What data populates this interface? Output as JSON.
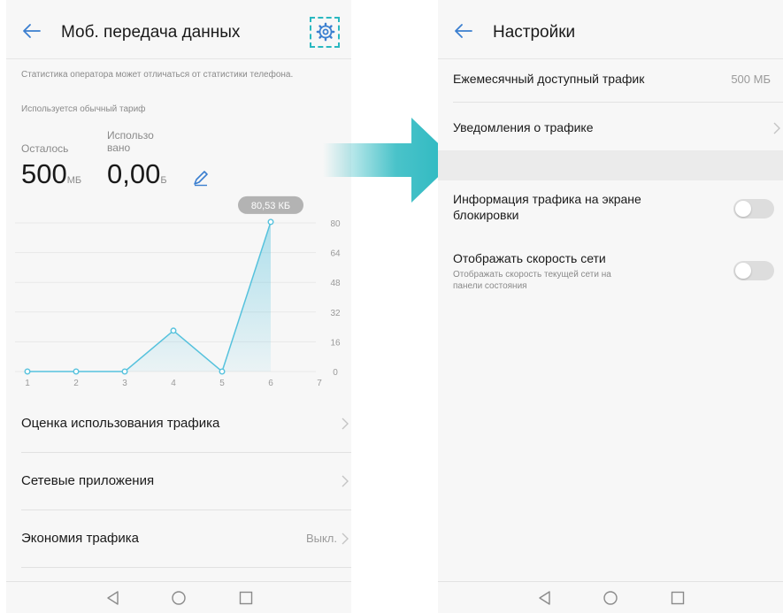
{
  "left": {
    "title": "Моб. передача данных",
    "note": "Статистика оператора может отличаться от статистики телефона.",
    "tariff": "Используется обычный тариф",
    "remaining": {
      "label": "Осталось",
      "value": "500",
      "unit": "МБ"
    },
    "used": {
      "label_line1": "Использо",
      "label_line2": "вано",
      "value": "0,00",
      "unit": "Б"
    },
    "rows": [
      {
        "label": "Оценка использования трафика",
        "value": ""
      },
      {
        "label": "Сетевые приложения",
        "value": ""
      },
      {
        "label": "Экономия трафика",
        "value": "Выкл."
      }
    ]
  },
  "right": {
    "title": "Настройки",
    "monthly": {
      "label": "Ежемесячный доступный трафик",
      "value": "500 МБ"
    },
    "alerts": {
      "label": "Уведомления о трафике"
    },
    "lockscreen": {
      "label_line1": "Информация трафика на экране",
      "label_line2": "блокировки",
      "enabled": false
    },
    "speed": {
      "label": "Отображать скорость сети",
      "desc_line1": "Отображать скорость текущей сети на",
      "desc_line2": "панели состояния",
      "enabled": false
    }
  },
  "colors": {
    "accent": "#2ab8c0",
    "link": "#3b7fd0",
    "chart_line": "#56c2dd",
    "tooltip": "#b3b3b3"
  },
  "chart_data": {
    "type": "area",
    "x": [
      1,
      2,
      3,
      4,
      5,
      6,
      7
    ],
    "values": [
      0,
      0,
      0,
      22,
      0,
      80.53
    ],
    "x_ticks": [
      "1",
      "2",
      "3",
      "4",
      "5",
      "6",
      "7"
    ],
    "y_ticks": [
      "0",
      "16",
      "32",
      "48",
      "64",
      "80"
    ],
    "ylim": [
      0,
      80
    ],
    "highlight_label": "80,53 КБ",
    "grid": true
  }
}
